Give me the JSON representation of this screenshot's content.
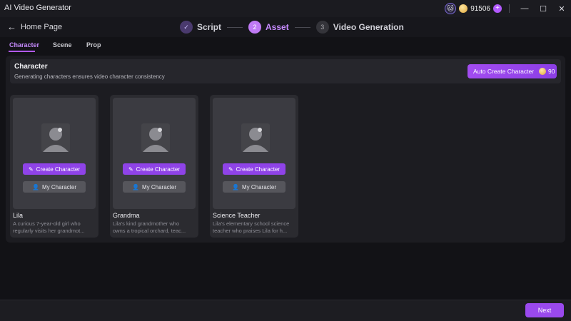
{
  "app": {
    "title": "AI Video Generator",
    "credits": "91506"
  },
  "nav": {
    "back_label": "Home Page",
    "steps": [
      {
        "index": "✓",
        "label": "Script"
      },
      {
        "index": "2",
        "label": "Asset"
      },
      {
        "index": "3",
        "label": "Video Generation"
      }
    ]
  },
  "tabs": [
    "Character",
    "Scene",
    "Prop"
  ],
  "banner": {
    "title": "Character",
    "subtitle": "Generating characters ensures video character consistency",
    "auto_button": "Auto Create Character",
    "auto_cost": "90"
  },
  "card_buttons": {
    "create": "Create Character",
    "mine": "My Character"
  },
  "characters": [
    {
      "name": "Lila",
      "desc1": "A curious 7-year-old girl who",
      "desc2": "regularly visits her grandmot..."
    },
    {
      "name": "Grandma",
      "desc1": "Lila's kind grandmother who",
      "desc2": "owns a tropical orchard, teac..."
    },
    {
      "name": "Science Teacher",
      "desc1": "Lila's elementary school science",
      "desc2": "teacher who praises Lila for h..."
    }
  ],
  "footer": {
    "next": "Next"
  },
  "colors": {
    "accent": "#9a49ee",
    "background": "#121216"
  }
}
